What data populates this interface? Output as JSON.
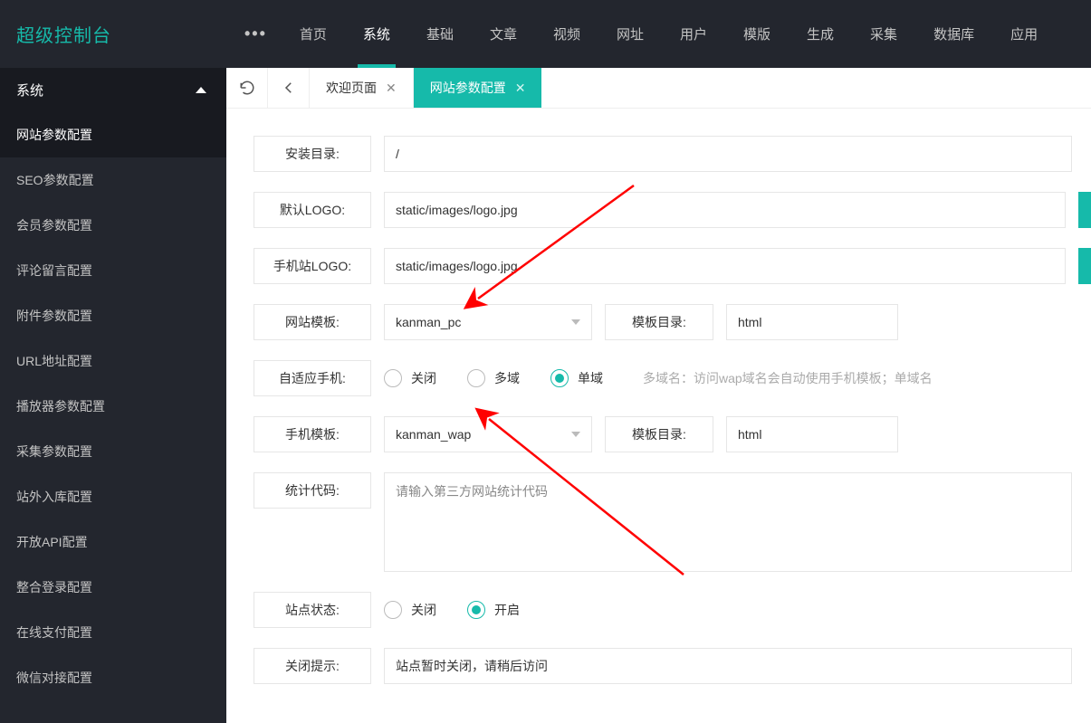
{
  "brand": "超级控制台",
  "topnav": {
    "items": [
      {
        "label": "首页"
      },
      {
        "label": "系统",
        "active": true
      },
      {
        "label": "基础"
      },
      {
        "label": "文章"
      },
      {
        "label": "视频"
      },
      {
        "label": "网址"
      },
      {
        "label": "用户"
      },
      {
        "label": "模版"
      },
      {
        "label": "生成"
      },
      {
        "label": "采集"
      },
      {
        "label": "数据库"
      },
      {
        "label": "应用"
      }
    ]
  },
  "sidebar": {
    "group_label": "系统",
    "items": [
      {
        "label": "网站参数配置",
        "active": true
      },
      {
        "label": "SEO参数配置"
      },
      {
        "label": "会员参数配置"
      },
      {
        "label": "评论留言配置"
      },
      {
        "label": "附件参数配置"
      },
      {
        "label": "URL地址配置"
      },
      {
        "label": "播放器参数配置"
      },
      {
        "label": "采集参数配置"
      },
      {
        "label": "站外入库配置"
      },
      {
        "label": "开放API配置"
      },
      {
        "label": "整合登录配置"
      },
      {
        "label": "在线支付配置"
      },
      {
        "label": "微信对接配置"
      }
    ]
  },
  "tabs": {
    "items": [
      {
        "label": "欢迎页面",
        "active": false
      },
      {
        "label": "网站参数配置",
        "active": true
      }
    ]
  },
  "form": {
    "install_dir": {
      "label": "安装目录:",
      "value": "/"
    },
    "default_logo": {
      "label": "默认LOGO:",
      "value": "static/images/logo.jpg"
    },
    "mobile_logo": {
      "label": "手机站LOGO:",
      "value": "static/images/logo.jpg"
    },
    "site_template": {
      "label": "网站模板:",
      "value": "kanman_pc",
      "dir_label": "模板目录:",
      "dir_value": "html"
    },
    "adaptive": {
      "label": "自适应手机:",
      "options": {
        "off": "关闭",
        "multi": "多域",
        "single": "单域"
      },
      "selected": "single",
      "hint": "多域名：访问wap域名会自动使用手机模板；单域名"
    },
    "mobile_template": {
      "label": "手机模板:",
      "value": "kanman_wap",
      "dir_label": "模板目录:",
      "dir_value": "html"
    },
    "stats_code": {
      "label": "统计代码:",
      "placeholder": "请输入第三方网站统计代码"
    },
    "site_status": {
      "label": "站点状态:",
      "options": {
        "off": "关闭",
        "on": "开启"
      },
      "selected": "on"
    },
    "close_tip": {
      "label": "关闭提示:",
      "value": "站点暂时关闭，请稍后访问"
    }
  }
}
